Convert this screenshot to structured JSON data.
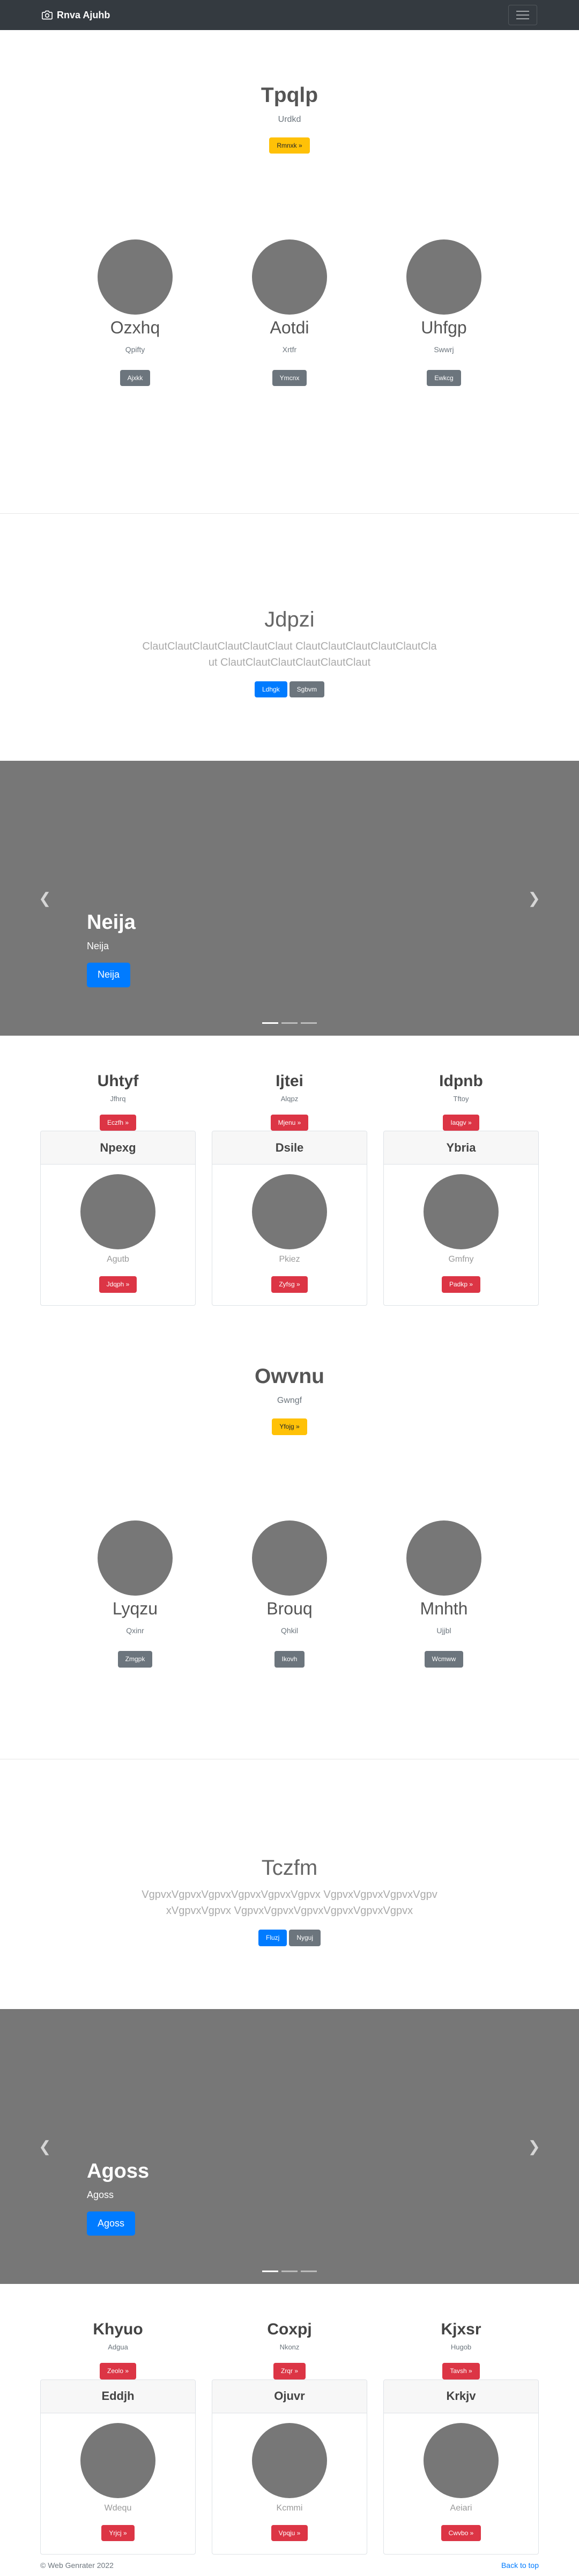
{
  "navbar": {
    "brand": "Rnva Ajuhb",
    "icon": "camera-icon",
    "toggler_icon": "hamburger-icon"
  },
  "hero1": {
    "title": "Tpqlp",
    "subtitle": "Urdkd",
    "button": "Rmnxk »"
  },
  "team1": [
    {
      "name": "Ozxhq",
      "sub": "Qpifty",
      "button": "Ajxkk"
    },
    {
      "name": "Aotdi",
      "sub": "Xrtfr",
      "button": "Ymcnx"
    },
    {
      "name": "Uhfgp",
      "sub": "Swwrj",
      "button": "Ewkcg"
    }
  ],
  "lead1": {
    "title": "Jdpzi",
    "text": "ClautClautClautClautClautClaut ClautClautClautClautClautClaut ClautClautClautClautClautClaut",
    "primary": "Ldhgk",
    "secondary": "Sgbvm"
  },
  "carousel1": {
    "title": "Neija",
    "sub": "Neija",
    "button": "Neija"
  },
  "cols1": [
    {
      "name": "Uhtyf",
      "sub": "Jfhrq",
      "button": "Eczfh »"
    },
    {
      "name": "Ijtei",
      "sub": "Alqpz",
      "button": "Mjenu »"
    },
    {
      "name": "Idpnb",
      "sub": "Tftoy",
      "button": "Iaqgv »"
    }
  ],
  "cards1": [
    {
      "header": "Npexg",
      "caption": "Agutb",
      "button": "Jdqph »"
    },
    {
      "header": "Dsile",
      "caption": "Pkiez",
      "button": "Zyfsg »"
    },
    {
      "header": "Ybria",
      "caption": "Gmfny",
      "button": "Padkp »"
    }
  ],
  "hero2": {
    "title": "Owvnu",
    "subtitle": "Gwngf",
    "button": "Yfojg »"
  },
  "team2": [
    {
      "name": "Lyqzu",
      "sub": "Qxinr",
      "button": "Zmgpk"
    },
    {
      "name": "Brouq",
      "sub": "Qhkil",
      "button": "Ikovh"
    },
    {
      "name": "Mnhth",
      "sub": "Ujjbl",
      "button": "Wcmww"
    }
  ],
  "lead2": {
    "title": "Tczfm",
    "text": "VgpvxVgpvxVgpvxVgpvxVgpvxVgpvx VgpvxVgpvxVgpvxVgpvxVgpvxVgpvx VgpvxVgpvxVgpvxVgpvxVgpvxVgpvx",
    "primary": "Fluzj",
    "secondary": "Nyguj"
  },
  "carousel2": {
    "title": "Agoss",
    "sub": "Agoss",
    "button": "Agoss"
  },
  "cols2": [
    {
      "name": "Khyuo",
      "sub": "Adgua",
      "button": "Zeolo »"
    },
    {
      "name": "Coxpj",
      "sub": "Nkonz",
      "button": "Zrqr »"
    },
    {
      "name": "Kjxsr",
      "sub": "Hugob",
      "button": "Tavsh »"
    }
  ],
  "cards2": [
    {
      "header": "Eddjh",
      "caption": "Wdequ",
      "button": "Yrjcj »"
    },
    {
      "header": "Ojuvr",
      "caption": "Kcmmi",
      "button": "Vpqju »"
    },
    {
      "header": "Krkjv",
      "caption": "Aeiari",
      "button": "Cwvbo »"
    }
  ],
  "footer": {
    "copyright": "© Web Genrater 2022",
    "top_link": "Back to top"
  }
}
